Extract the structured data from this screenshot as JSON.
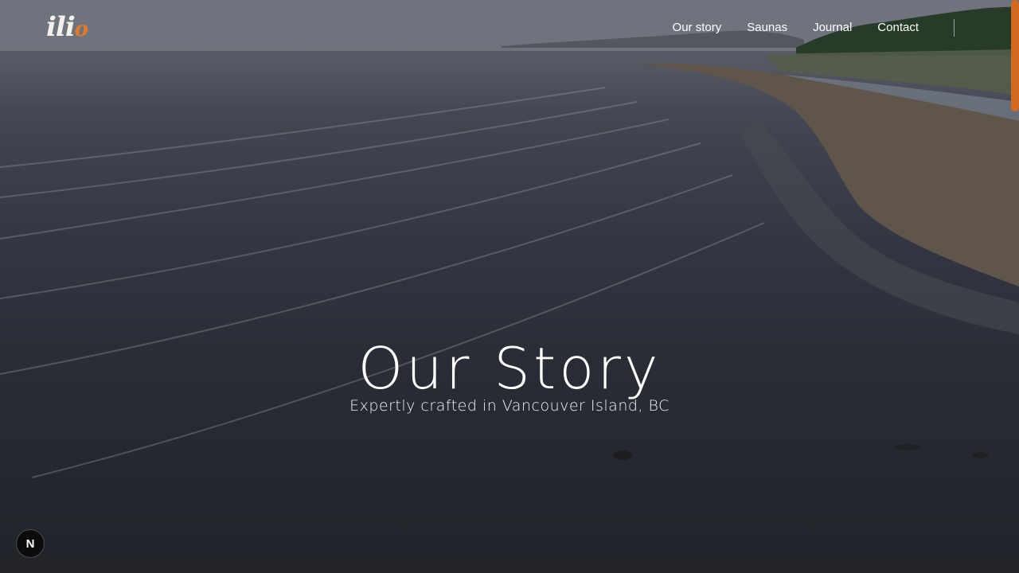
{
  "brand": {
    "logo_main": "ili",
    "logo_accent": "o",
    "accent_color": "#d2691e"
  },
  "nav": {
    "items": [
      {
        "label": "Our story"
      },
      {
        "label": "Saunas"
      },
      {
        "label": "Journal"
      },
      {
        "label": "Contact"
      }
    ]
  },
  "hero": {
    "title": "Our Story",
    "subtitle": "Expertly crafted in Vancouver Island, BC"
  },
  "dev_badge": {
    "label": "N",
    "icon": "nextjs-icon"
  },
  "scrollbar": {
    "position_fraction": 0.0
  }
}
